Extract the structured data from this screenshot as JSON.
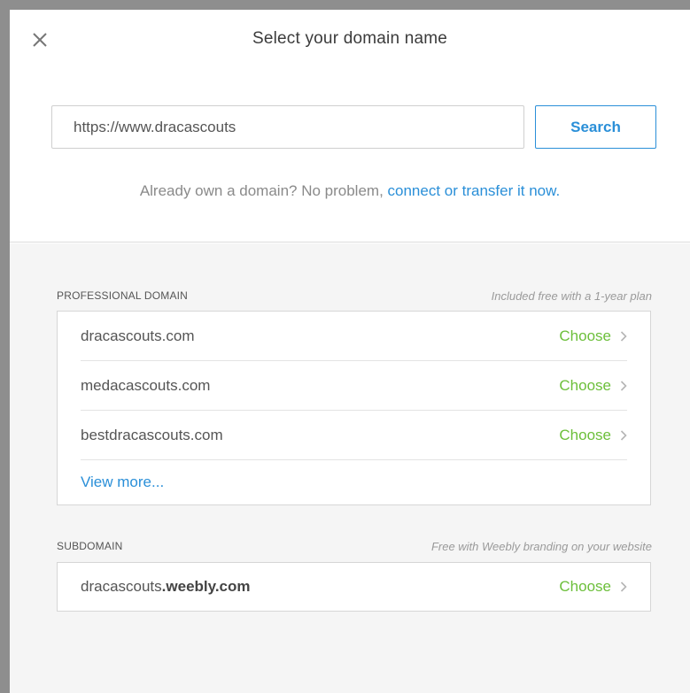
{
  "modal": {
    "title": "Select your domain name"
  },
  "search": {
    "value": "https://www.dracascouts",
    "button_label": "Search"
  },
  "own_domain": {
    "text": "Already own a domain? No problem, ",
    "link": "connect or transfer it now."
  },
  "professional": {
    "label": "PROFESSIONAL DOMAIN",
    "note": "Included free with a 1-year plan",
    "items": [
      {
        "domain": "dracascouts.com",
        "action": "Choose"
      },
      {
        "domain": "medacascouts.com",
        "action": "Choose"
      },
      {
        "domain": "bestdracascouts.com",
        "action": "Choose"
      }
    ],
    "view_more": "View more..."
  },
  "subdomain": {
    "label": "SUBDOMAIN",
    "note": "Free with Weebly branding on your website",
    "name": "dracascouts",
    "suffix": ".weebly.com",
    "action": "Choose"
  },
  "colors": {
    "accent_blue": "#2a8fd8",
    "choose_green": "#6cbf3a"
  }
}
